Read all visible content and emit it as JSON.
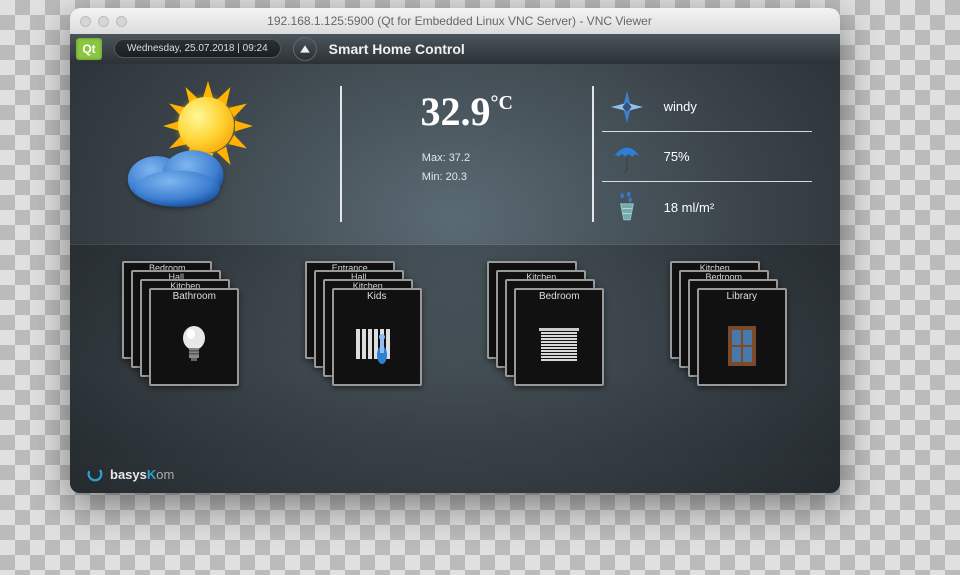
{
  "window": {
    "title": "192.168.1.125:5900 (Qt for Embedded Linux VNC Server) - VNC Viewer"
  },
  "topbar": {
    "logo_text": "Qt",
    "datetime": "Wednesday, 25.07.2018 | 09:24",
    "app_title": "Smart Home Control"
  },
  "weather": {
    "temp_value": "32.9",
    "temp_unit": "°C",
    "max_label": "Max: 37.2",
    "min_label": "Min: 20.3",
    "conditions": {
      "wind": "windy",
      "humidity": "75%",
      "precip": "18 ml/m²"
    }
  },
  "stacks": [
    {
      "back3": "Bedroom",
      "back2": "Hall",
      "back1": "Kitchen",
      "front": "Bathroom",
      "icon": "bulb"
    },
    {
      "back3": "Entrance",
      "back2": "Hall",
      "back1": "Kitchen",
      "front": "Kids",
      "icon": "radiator"
    },
    {
      "back3": "",
      "back2": "Kitchen",
      "back1": "",
      "front": "Bedroom",
      "icon": "blinds"
    },
    {
      "back3": "Kitchen",
      "back2": "Bedroom",
      "back1": "",
      "front": "Library",
      "icon": "window"
    }
  ],
  "footer": {
    "brand1": "basys",
    "brand2": "K",
    "brand3": "om"
  }
}
